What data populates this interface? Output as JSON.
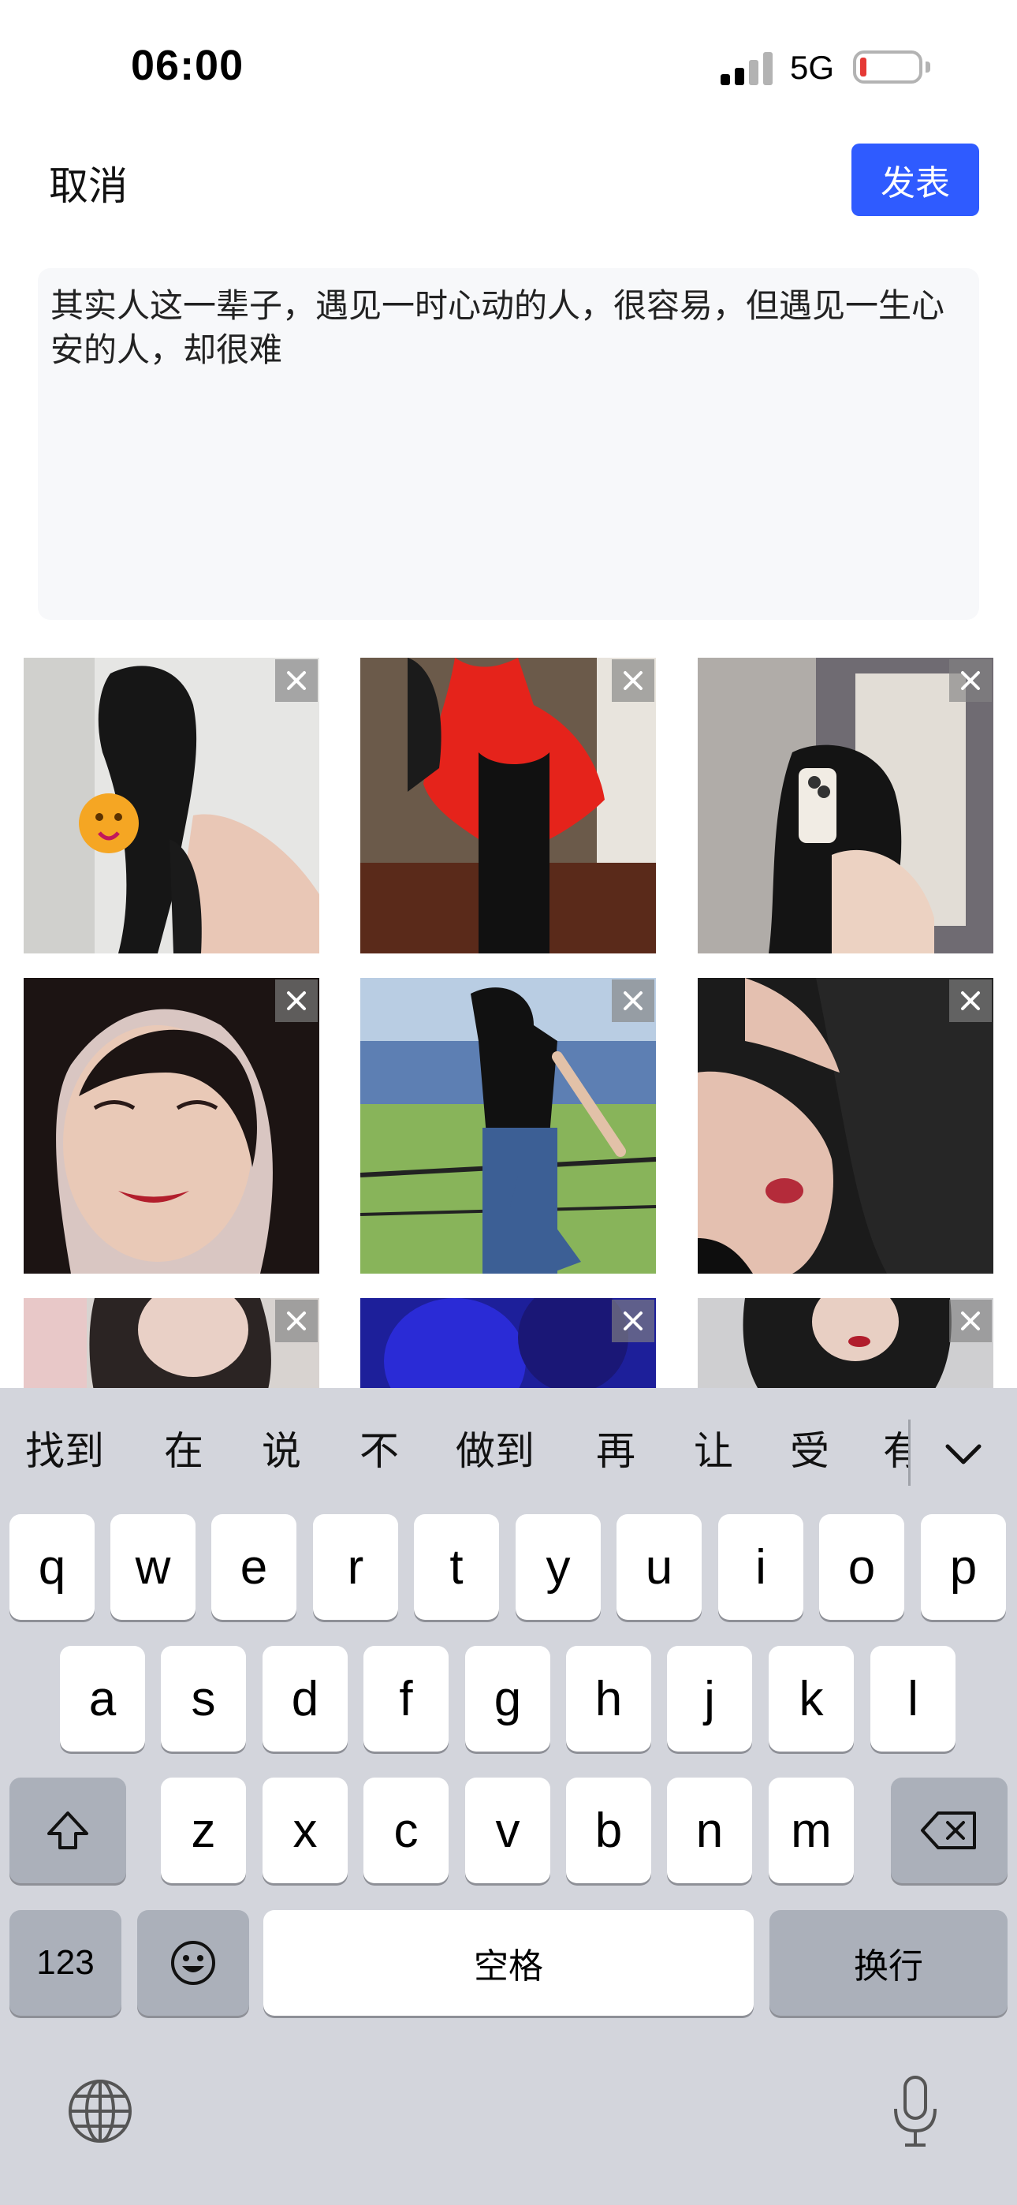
{
  "status": {
    "time": "06:00",
    "network": "5G",
    "battery_color": "#e53935"
  },
  "header": {
    "cancel": "取消",
    "publish": "发表",
    "accent": "#2f5bff"
  },
  "post": {
    "text": "其实人这一辈子，遇见一时心动的人，很容易，但遇见一生心安的人，却很难"
  },
  "photos": [
    {
      "name": "photo-1",
      "remove_icon": "close-icon"
    },
    {
      "name": "photo-2",
      "remove_icon": "close-icon"
    },
    {
      "name": "photo-3",
      "remove_icon": "close-icon"
    },
    {
      "name": "photo-4",
      "remove_icon": "close-icon"
    },
    {
      "name": "photo-5",
      "remove_icon": "close-icon"
    },
    {
      "name": "photo-6",
      "remove_icon": "close-icon"
    },
    {
      "name": "photo-7",
      "remove_icon": "close-icon"
    },
    {
      "name": "photo-8",
      "remove_icon": "close-icon"
    },
    {
      "name": "photo-9",
      "remove_icon": "close-icon"
    }
  ],
  "keyboard": {
    "candidates": [
      "找到",
      "在",
      "说",
      "不",
      "做到",
      "再",
      "让",
      "受",
      "有"
    ],
    "row1": [
      "q",
      "w",
      "e",
      "r",
      "t",
      "y",
      "u",
      "i",
      "o",
      "p"
    ],
    "row2": [
      "a",
      "s",
      "d",
      "f",
      "g",
      "h",
      "j",
      "k",
      "l"
    ],
    "row3": [
      "z",
      "x",
      "c",
      "v",
      "b",
      "n",
      "m"
    ],
    "numbers": "123",
    "space": "空格",
    "return": "换行"
  }
}
